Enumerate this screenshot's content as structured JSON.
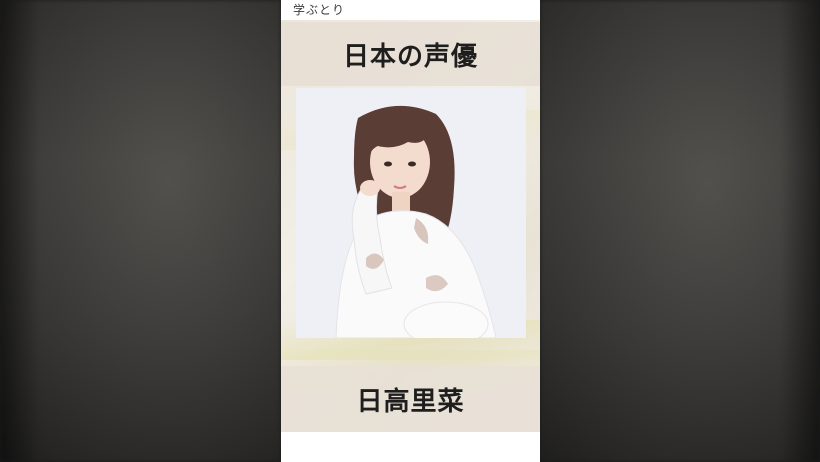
{
  "video": {
    "channel_label": "学ぶとり",
    "title": "日本の声優",
    "name": "日高里菜"
  },
  "colors": {
    "background": "#1b1b1b",
    "paper": "#ece6da",
    "text": "#1e1e1e"
  }
}
